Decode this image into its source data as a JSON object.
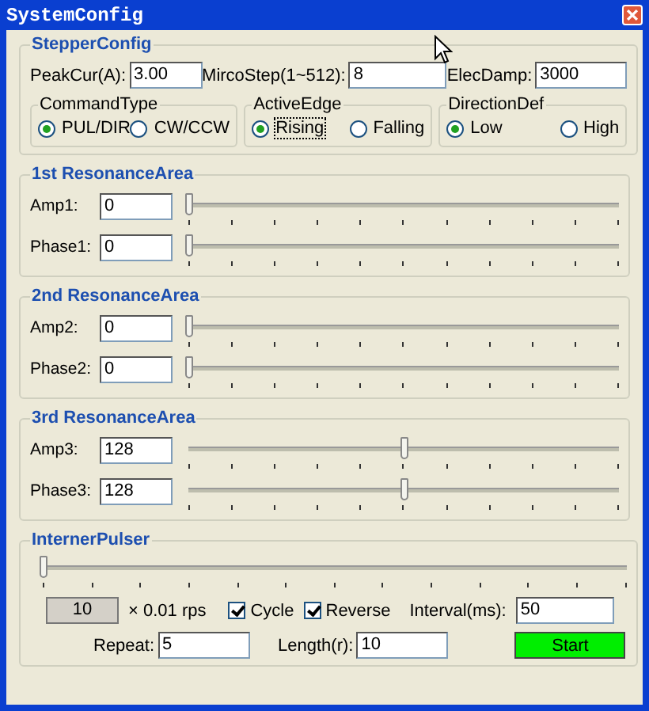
{
  "window": {
    "title": "SystemConfig"
  },
  "stepper_config": {
    "title": "StepperConfig",
    "fields": [
      {
        "label": "PeakCur(A):",
        "value": "3.00"
      },
      {
        "label": "MircoStep(1~512):",
        "value": "8"
      },
      {
        "label": "ElecDamp:",
        "value": "3000"
      }
    ],
    "groups": [
      {
        "title": "CommandType",
        "options": [
          {
            "label": "PUL/DIR",
            "selected": true
          },
          {
            "label": "CW/CCW",
            "selected": false
          }
        ]
      },
      {
        "title": "ActiveEdge",
        "options": [
          {
            "label": "Rising",
            "selected": true
          },
          {
            "label": "Falling",
            "selected": false
          }
        ]
      },
      {
        "title": "DirectionDef",
        "options": [
          {
            "label": "Low",
            "selected": true
          },
          {
            "label": "High",
            "selected": false
          }
        ]
      }
    ]
  },
  "resonance_areas": [
    {
      "title": "1st ResonanceArea",
      "rows": [
        {
          "label": "Amp1:",
          "value": "0",
          "level": 0
        },
        {
          "label": "Phase1:",
          "value": "0",
          "level": 0
        }
      ]
    },
    {
      "title": "2nd ResonanceArea",
      "rows": [
        {
          "label": "Amp2:",
          "value": "0",
          "level": 0
        },
        {
          "label": "Phase2:",
          "value": "0",
          "level": 0
        }
      ]
    },
    {
      "title": "3rd ResonanceArea",
      "rows": [
        {
          "label": "Amp3:",
          "value": "128",
          "level": 0.5
        },
        {
          "label": "Phase3:",
          "value": "128",
          "level": 0.5
        }
      ]
    }
  ],
  "interner_pulser": {
    "title": "InternerPulser",
    "level": 0,
    "speed": "10",
    "unit": "× 0.01 rps",
    "checkboxes": [
      {
        "label": "Cycle",
        "checked": true
      },
      {
        "label": "Reverse",
        "checked": true
      }
    ],
    "interval": {
      "label": "Interval(ms):",
      "value": "50"
    },
    "repeat": {
      "label": "Repeat:",
      "value": "5"
    },
    "length": {
      "label": "Length(r):",
      "value": "10"
    },
    "start_button": "Start"
  }
}
